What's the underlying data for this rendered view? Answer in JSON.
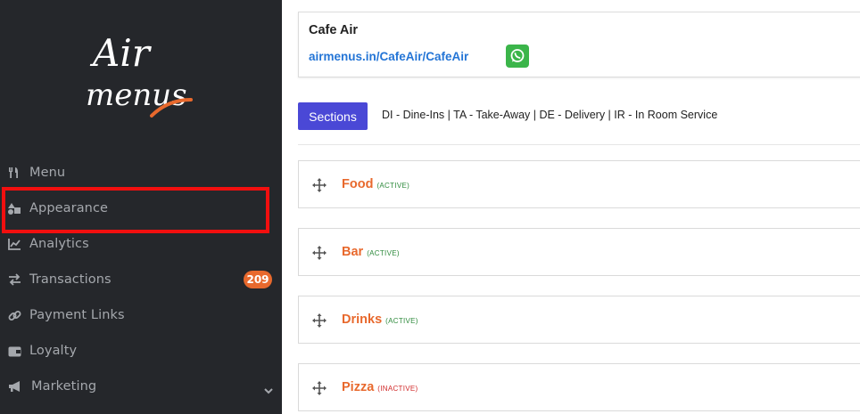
{
  "logo": {
    "line1": "Air",
    "line2": "menus"
  },
  "sidebar": {
    "items": [
      {
        "label": "Menu",
        "icon": "utensils-icon"
      },
      {
        "label": "Appearance",
        "icon": "shapes-icon"
      },
      {
        "label": "Analytics",
        "icon": "chart-line-icon"
      },
      {
        "label": "Transactions",
        "icon": "exchange-icon",
        "badge": "209"
      },
      {
        "label": "Payment Links",
        "icon": "link-icon"
      },
      {
        "label": "Loyalty",
        "icon": "wallet-icon"
      },
      {
        "label": "Marketing",
        "icon": "bullhorn-icon"
      }
    ]
  },
  "cafe": {
    "name": "Cafe Air",
    "link": "airmenus.in/CafeAir/CafeAir"
  },
  "sections_button": "Sections",
  "legend_text": "DI - Dine-Ins | TA - Take-Away | DE - Delivery | IR - In Room Service",
  "sections": [
    {
      "name": "Food",
      "status": "(ACTIVE)"
    },
    {
      "name": "Bar",
      "status": "(ACTIVE)"
    },
    {
      "name": "Drinks",
      "status": "(ACTIVE)"
    },
    {
      "name": "Pizza",
      "status": "(INACTIVE)"
    }
  ],
  "colors": {
    "sidebar_bg": "#25272b",
    "accent_orange": "#e8692d",
    "sections_button": "#4a48d6",
    "highlight": "#f20f0f"
  }
}
